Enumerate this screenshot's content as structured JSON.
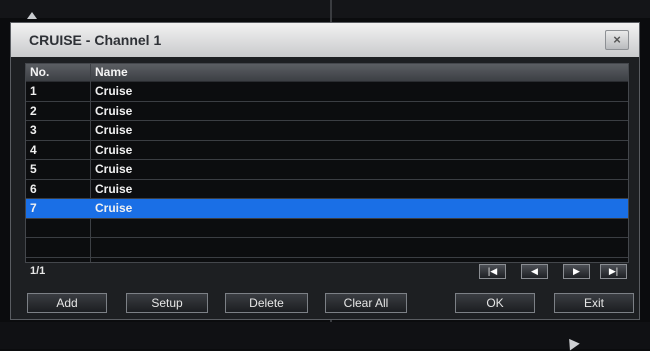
{
  "dialog": {
    "title": "CRUISE - Channel 1",
    "close_label": "×"
  },
  "table": {
    "headers": {
      "no": "No.",
      "name": "Name"
    },
    "rows": [
      {
        "no": "1",
        "name": "Cruise"
      },
      {
        "no": "2",
        "name": "Cruise"
      },
      {
        "no": "3",
        "name": "Cruise"
      },
      {
        "no": "4",
        "name": "Cruise"
      },
      {
        "no": "5",
        "name": "Cruise"
      },
      {
        "no": "6",
        "name": "Cruise"
      },
      {
        "no": "7",
        "name": "Cruise",
        "selected": true
      }
    ],
    "empty_rows": 2
  },
  "pager": {
    "page": "1/1",
    "first_icon": "skip-first-icon",
    "prev_icon": "prev-icon",
    "next_icon": "next-icon",
    "last_icon": "skip-last-icon"
  },
  "buttons": {
    "add": "Add",
    "setup": "Setup",
    "delete": "Delete",
    "clear_all": "Clear All",
    "ok": "OK",
    "exit": "Exit"
  },
  "colors": {
    "selection": "#1a6fe6",
    "dialog_bg": "#1d1f22",
    "title_text": "#2e3136"
  }
}
